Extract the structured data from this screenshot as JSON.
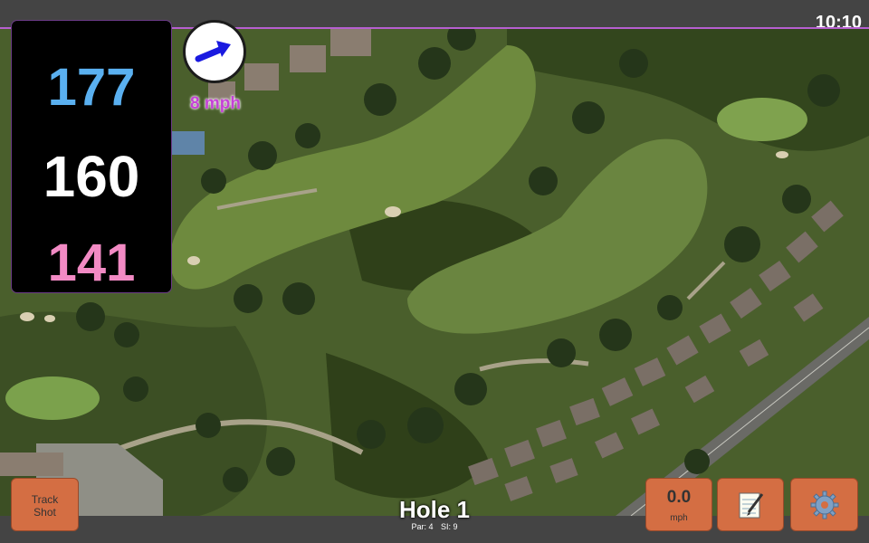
{
  "status": {
    "time": "10:10"
  },
  "yardage": {
    "back": "177",
    "middle": "160",
    "front": "141"
  },
  "wind": {
    "speed_label": "8 mph",
    "icon": "arrow-icon",
    "color": "#c542d6"
  },
  "hole": {
    "title": "Hole 1",
    "par_label": "Par: 4",
    "si_label": "SI: 9"
  },
  "buttons": {
    "track_line1": "Track",
    "track_line2": "Shot",
    "speed_value": "0.0",
    "speed_unit": "mph",
    "notes_icon": "notepad-icon",
    "settings_icon": "gear-icon"
  },
  "colors": {
    "button": "#d46e43",
    "back_yardage": "#5ab0f0",
    "middle_yardage": "#ffffff",
    "front_yardage": "#f28ac4",
    "wind_arrow": "#1a1ae0"
  }
}
